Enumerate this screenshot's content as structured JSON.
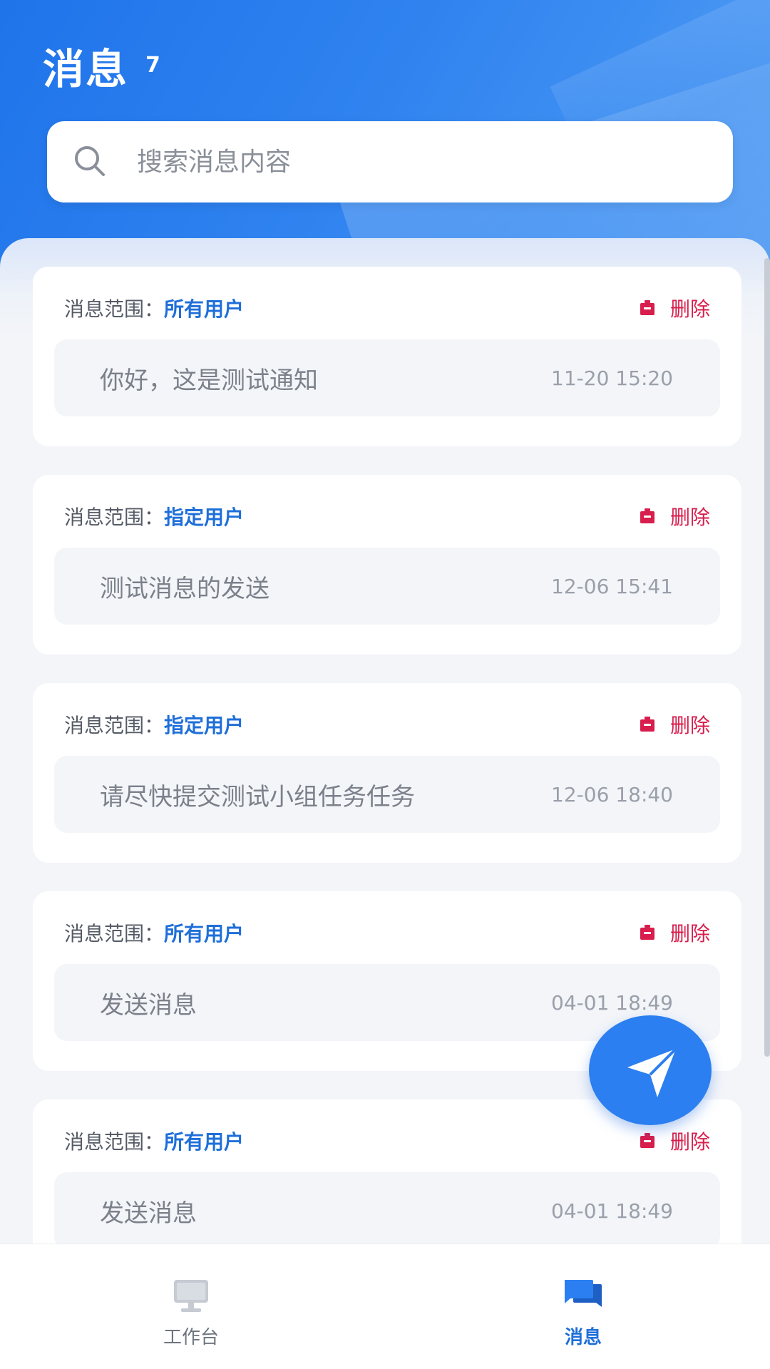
{
  "header": {
    "title": "消息",
    "count": "7"
  },
  "search": {
    "placeholder": "搜索消息内容",
    "icon": "search-icon"
  },
  "messages": [
    {
      "scope_label": "消息范围：",
      "scope_value": "所有用户",
      "delete_label": "删除",
      "text": "你好，这是测试通知",
      "time": "11-20 15:20"
    },
    {
      "scope_label": "消息范围：",
      "scope_value": "指定用户",
      "delete_label": "删除",
      "text": "测试消息的发送",
      "time": "12-06 15:41"
    },
    {
      "scope_label": "消息范围：",
      "scope_value": "指定用户",
      "delete_label": "删除",
      "text": "请尽快提交测试小组任务任务",
      "time": "12-06 18:40"
    },
    {
      "scope_label": "消息范围：",
      "scope_value": "所有用户",
      "delete_label": "删除",
      "text": "发送消息",
      "time": "04-01 18:49"
    },
    {
      "scope_label": "消息范围：",
      "scope_value": "所有用户",
      "delete_label": "删除",
      "text": "发送消息",
      "time": "04-01 18:49"
    }
  ],
  "fab": {
    "icon": "send-icon"
  },
  "tabbar": {
    "tabs": [
      {
        "label": "工作台",
        "icon": "monitor-icon",
        "active": false
      },
      {
        "label": "消息",
        "icon": "chat-icon",
        "active": true
      }
    ]
  },
  "colors": {
    "primary": "#2b7ff0",
    "scope_value": "#1f6fd9",
    "delete": "#d81e4c",
    "background": "#f3f5f9"
  }
}
